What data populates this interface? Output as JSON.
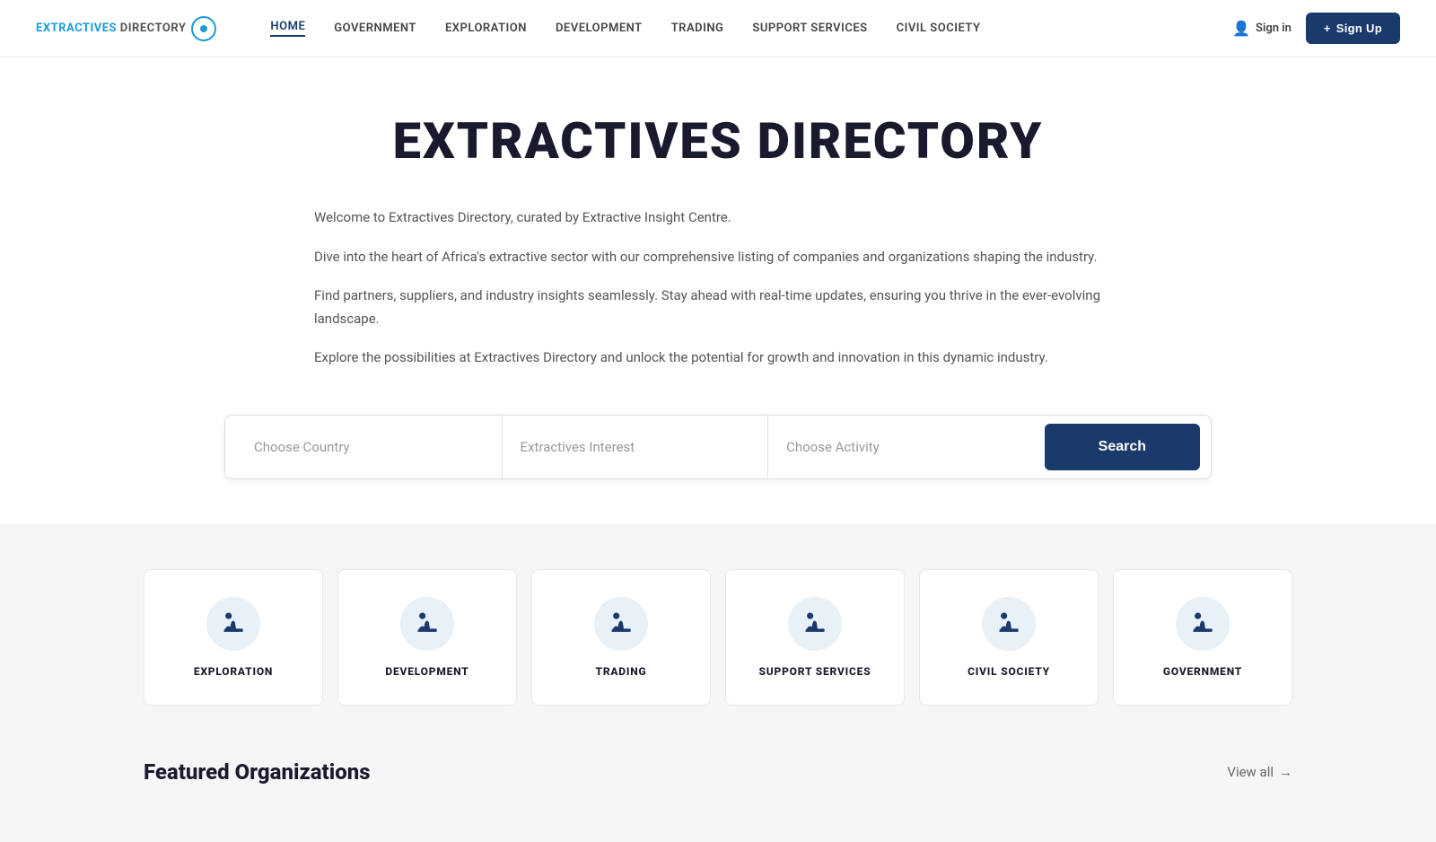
{
  "navbar": {
    "logo_text_extractives": "EXTRACTIVES",
    "logo_text_directory": " DIRECTORY",
    "nav_items": [
      {
        "label": "HOME",
        "active": true
      },
      {
        "label": "GOVERNMENT",
        "active": false
      },
      {
        "label": "EXPLORATION",
        "active": false
      },
      {
        "label": "DEVELOPMENT",
        "active": false
      },
      {
        "label": "TRADING",
        "active": false
      },
      {
        "label": "SUPPORT SERVICES",
        "active": false
      },
      {
        "label": "CIVIL SOCIETY",
        "active": false
      }
    ],
    "sign_in_label": "Sign in",
    "sign_up_label": "Sign Up"
  },
  "hero": {
    "title": "EXTRACTIVES DIRECTORY",
    "paragraphs": [
      "Welcome to Extractives Directory, curated by Extractive Insight Centre.",
      "Dive into the heart of Africa's extractive sector with our comprehensive listing of companies and organizations shaping the industry.",
      "Find partners, suppliers, and industry insights seamlessly. Stay ahead with real-time updates, ensuring you thrive in the ever-evolving landscape.",
      "Explore the possibilities at Extractives Directory and unlock the potential for growth and innovation in this dynamic industry."
    ]
  },
  "search": {
    "country_placeholder": "Choose Country",
    "interest_placeholder": "Extractives Interest",
    "activity_placeholder": "Choose Activity",
    "button_label": "Search"
  },
  "categories": [
    {
      "label": "EXPLORATION"
    },
    {
      "label": "DEVELOPMENT"
    },
    {
      "label": "TRADING"
    },
    {
      "label": "SUPPORT SERVICES"
    },
    {
      "label": "CIVIL SOCIETY"
    },
    {
      "label": "GOVERNMENT"
    }
  ],
  "featured": {
    "title": "Featured Organizations",
    "view_all_label": "View all",
    "arrow": "→"
  },
  "colors": {
    "primary": "#1a3a6b",
    "accent": "#1a9cd8",
    "bg": "#f5f6f8",
    "white": "#ffffff"
  }
}
